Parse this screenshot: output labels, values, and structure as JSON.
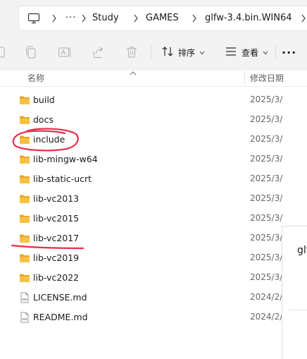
{
  "address_bar": {
    "items": [
      "Study",
      "GAMES",
      "glfw-3.4.bin.WIN64"
    ],
    "overflow_label": "···"
  },
  "toolbar": {
    "sort_label": "排序",
    "view_label": "查看",
    "more_label": "···"
  },
  "columns": {
    "name": "名称",
    "date": "修改日期"
  },
  "files": [
    {
      "name": "build",
      "date": "2025/3/",
      "type": "folder"
    },
    {
      "name": "docs",
      "date": "2025/3/",
      "type": "folder"
    },
    {
      "name": "include",
      "date": "2025/3/",
      "type": "folder"
    },
    {
      "name": "lib-mingw-w64",
      "date": "2025/3/",
      "type": "folder"
    },
    {
      "name": "lib-static-ucrt",
      "date": "2025/3/",
      "type": "folder"
    },
    {
      "name": "lib-vc2013",
      "date": "2025/3/",
      "type": "folder"
    },
    {
      "name": "lib-vc2015",
      "date": "2025/3/",
      "type": "folder"
    },
    {
      "name": "lib-vc2017",
      "date": "2025/3/",
      "type": "folder"
    },
    {
      "name": "lib-vc2019",
      "date": "2025/3/",
      "type": "folder"
    },
    {
      "name": "lib-vc2022",
      "date": "2025/3/",
      "type": "folder"
    },
    {
      "name": "LICENSE.md",
      "date": "2024/2/",
      "type": "md"
    },
    {
      "name": "README.md",
      "date": "2024/2/",
      "type": "md"
    }
  ],
  "overlay": {
    "title": "glf"
  },
  "colors": {
    "folder": "#f8c146",
    "folder_dark": "#e9a825",
    "annotation": "#e8304d"
  }
}
